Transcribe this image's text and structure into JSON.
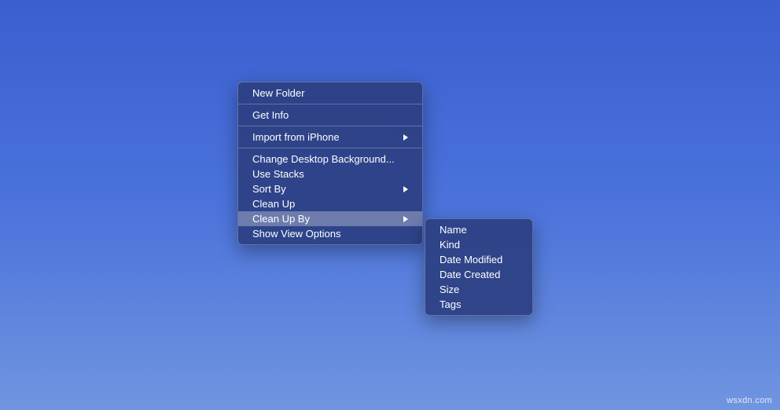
{
  "contextMenu": {
    "items": [
      {
        "label": "New Folder",
        "hasSubmenu": false
      },
      {
        "label": "Get Info",
        "hasSubmenu": false
      },
      {
        "label": "Import from iPhone",
        "hasSubmenu": true
      },
      {
        "label": "Change Desktop Background...",
        "hasSubmenu": false
      },
      {
        "label": "Use Stacks",
        "hasSubmenu": false
      },
      {
        "label": "Sort By",
        "hasSubmenu": true
      },
      {
        "label": "Clean Up",
        "hasSubmenu": false
      },
      {
        "label": "Clean Up By",
        "hasSubmenu": true,
        "highlighted": true
      },
      {
        "label": "Show View Options",
        "hasSubmenu": false
      }
    ]
  },
  "submenu": {
    "items": [
      {
        "label": "Name"
      },
      {
        "label": "Kind"
      },
      {
        "label": "Date Modified"
      },
      {
        "label": "Date Created"
      },
      {
        "label": "Size"
      },
      {
        "label": "Tags"
      }
    ]
  },
  "watermark": "wsxdn.com"
}
